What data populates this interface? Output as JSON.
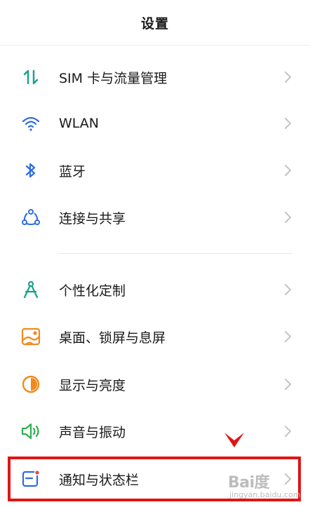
{
  "header": {
    "title": "设置"
  },
  "items": [
    {
      "label": "SIM 卡与流量管理",
      "icon": "sim-data-icon"
    },
    {
      "label": "WLAN",
      "icon": "wifi-icon"
    },
    {
      "label": "蓝牙",
      "icon": "bluetooth-icon"
    },
    {
      "label": "连接与共享",
      "icon": "connection-share-icon"
    },
    {
      "label": "个性化定制",
      "icon": "personalization-icon"
    },
    {
      "label": "桌面、锁屏与息屏",
      "icon": "wallpaper-icon"
    },
    {
      "label": "显示与亮度",
      "icon": "brightness-icon"
    },
    {
      "label": "声音与振动",
      "icon": "sound-icon"
    },
    {
      "label": "通知与状态栏",
      "icon": "notification-icon"
    }
  ],
  "watermark": {
    "main": "Bai度",
    "sub": "jingyan.baidu.com"
  },
  "colors": {
    "highlight": "#e01515",
    "teal": "#19a08a",
    "blue": "#2d6be0",
    "orange": "#f08a1c",
    "green": "#2fae52",
    "red": "#e5484d"
  }
}
